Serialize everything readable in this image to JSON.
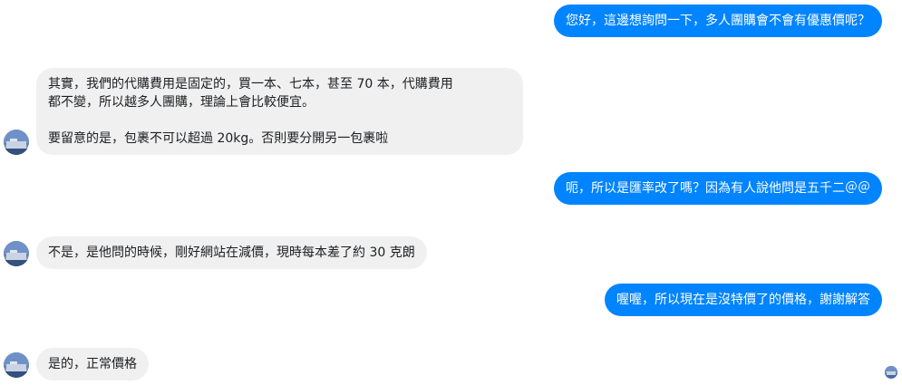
{
  "messages": {
    "m1": "您好，這邊想詢問一下，多人團購會不會有優惠價呢？",
    "m2": {
      "line1": "其實，我們的代購費用是固定的，買一本、七本，甚至 70 本，代購費用",
      "line2": "都不變，所以越多人團購，理論上會比較便宜。",
      "line3": "要留意的是，包裹不可以超過 20kg。否則要分開另一包裹啦"
    },
    "m3": "呃，所以是匯率改了嗎？因為有人說他問是五千二＠＠",
    "m4": "不是，是他問的時候，剛好網站在減價，現時每本差了約 30 克朗",
    "m5": "喔喔，所以現在是沒特價了的價格，謝謝解答",
    "m6": "是的，正常價格"
  },
  "colors": {
    "outgoing_bubble": "#0084ff",
    "incoming_bubble": "#f0f0f0"
  }
}
